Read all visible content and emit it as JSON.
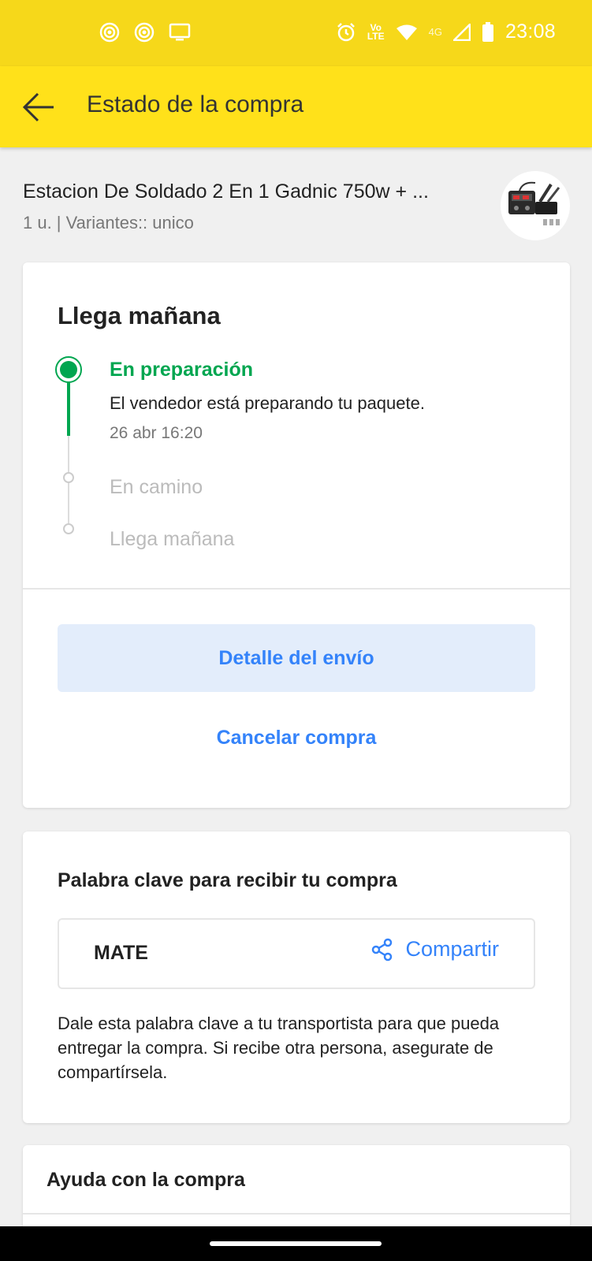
{
  "status_bar": {
    "time": "23:08",
    "volte_label_top": "Vo",
    "volte_label_bottom": "LTE",
    "network_label": "4G",
    "icons": [
      "signal-app-icon",
      "signal-app-icon",
      "cast-screen-icon",
      "alarm-icon",
      "volte-icon",
      "wifi-icon",
      "cellular-signal-icon",
      "battery-icon"
    ]
  },
  "app_bar": {
    "title": "Estado de la compra",
    "back_icon": "arrow-left-icon"
  },
  "product": {
    "name": "Estacion De Soldado 2 En 1 Gadnic 750w + ...",
    "variant": "1 u. | Variantes:: unico",
    "thumb_icon": "soldering-station-thumbnail"
  },
  "status_card": {
    "title": "Llega mañana",
    "steps": [
      {
        "title": "En preparación",
        "description": "El vendedor está preparando tu paquete.",
        "date": "26 abr 16:20",
        "state": "active"
      },
      {
        "title": "En camino",
        "state": "pending"
      },
      {
        "title": "Llega mañana",
        "state": "pending"
      }
    ],
    "primary_button": "Detalle del envío",
    "secondary_button": "Cancelar compra"
  },
  "keyword_card": {
    "title": "Palabra clave para recibir tu compra",
    "keyword": "MATE",
    "share_label": "Compartir",
    "share_icon": "share-icon",
    "help_text": "Dale esta palabra clave a tu transportista para que pueda entregar la compra. Si recibe otra persona, asegurate de compartírsela."
  },
  "help_card": {
    "title": "Ayuda con la compra"
  },
  "colors": {
    "status_bar": "#f6d81a",
    "app_bar": "#ffe11a",
    "accent_green": "#00a650",
    "accent_blue": "#3483fa",
    "button_bg": "#e3edfb"
  }
}
